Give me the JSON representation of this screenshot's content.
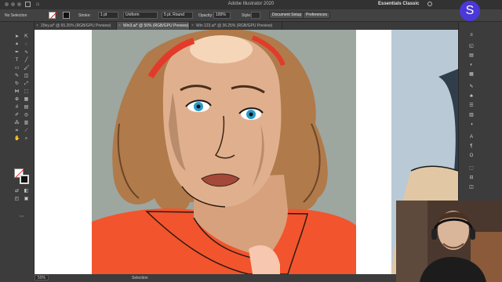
{
  "window": {
    "title": "Adobe Illustrator 2020",
    "workspace": "Essentials Classic"
  },
  "control_bar": {
    "selection_label": "No Selection",
    "stroke_label": "Stroke:",
    "stroke_value": "1 pt",
    "profile": "Uniform",
    "brush": "5 pt. Round",
    "opacity_label": "Opacity:",
    "opacity_value": "100%",
    "style_label": "Style:",
    "document_setup": "Document Setup",
    "preferences": "Preferences"
  },
  "tabs": [
    {
      "label": "20ey.ai* @ 65.25% (RGB/GPU Preview)",
      "active": false
    },
    {
      "label": "Win3.ai* @ 50% (RGB/GPU Preview)",
      "active": true
    },
    {
      "label": "Win 123.ai* @ 36.25% (RGB/GPU Preview)",
      "active": false
    }
  ],
  "status_bar": {
    "zoom": "50%",
    "mode": "Selection"
  },
  "avatar": {
    "letter": "S",
    "color": "#4b38d8"
  },
  "colors": {
    "artboard_bg": "#9ea6a0",
    "hair": "#b07a4a",
    "skin": "#e0b08e",
    "shirt": "#f2542d",
    "headband": "#e33a2b",
    "lips": "#a4483a",
    "eyes": "#2a9bc7"
  }
}
